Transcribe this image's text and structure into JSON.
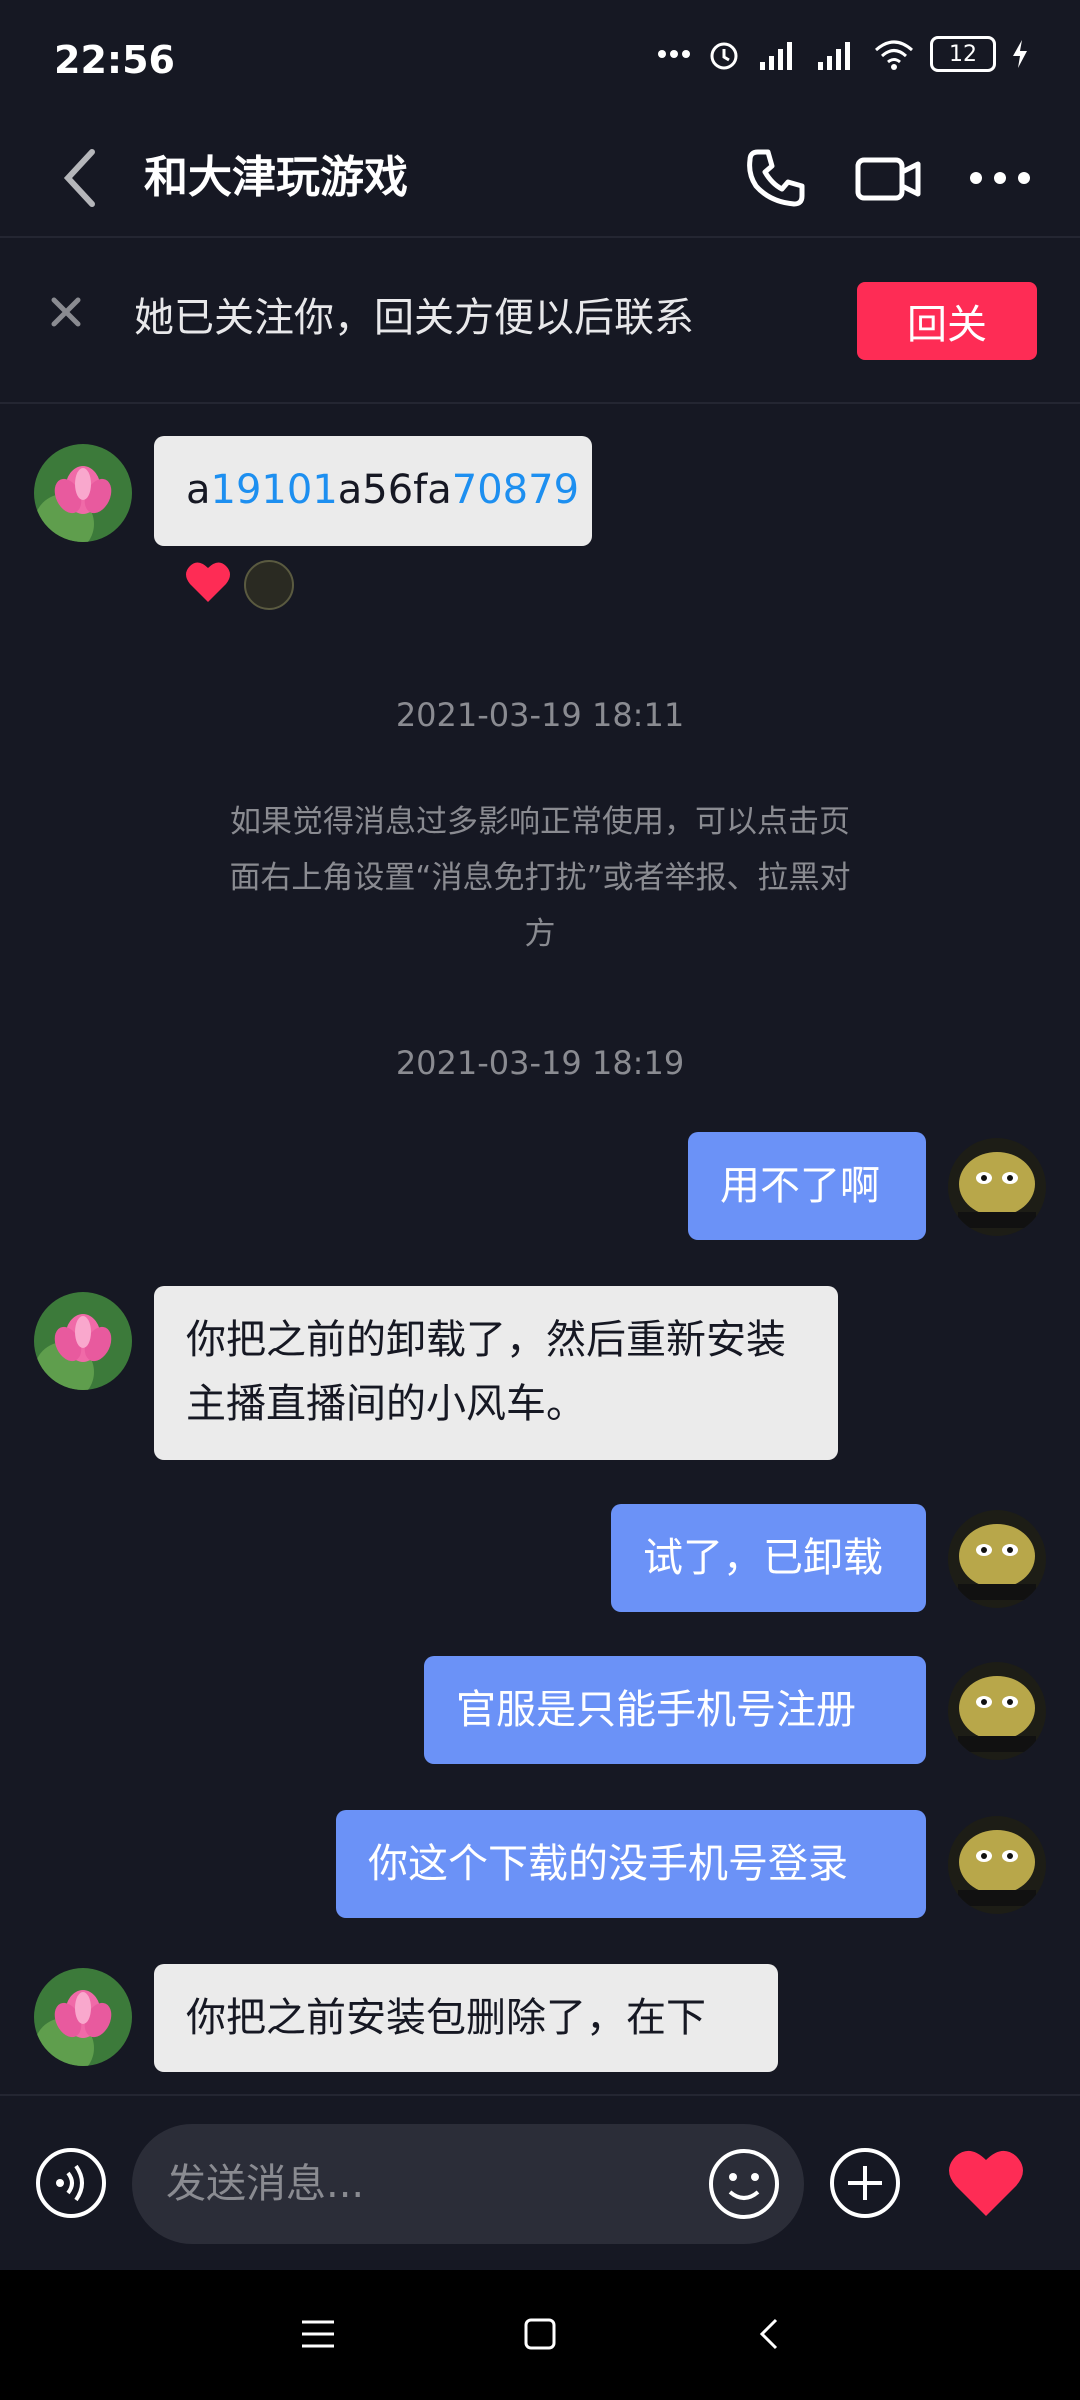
{
  "status": {
    "time": "22:56",
    "battery": "12"
  },
  "header": {
    "title": "和大津玩游戏"
  },
  "follow": {
    "text": "她已关注你，回关方便以后联系",
    "button": "回关"
  },
  "messages": {
    "m1": {
      "parts": [
        "a",
        "19101",
        "a56fa",
        "70879"
      ]
    },
    "ts1": "2021-03-19 18:11",
    "notice": "如果觉得消息过多影响正常使用，可以点击页面右上角设置“消息免打扰”或者举报、拉黑对方",
    "ts2": "2021-03-19 18:19",
    "m2": "用不了啊",
    "m3": "你把之前的卸载了，然后重新安装主播直播间的小风车。",
    "m4": "试了，已卸载",
    "m5": "官服是只能手机号注册",
    "m6": "你这个下载的没手机号登录",
    "m7": "你把之前安装包删除了，在下"
  },
  "compose": {
    "placeholder": "发送消息..."
  },
  "colors": {
    "background": "#161823",
    "accent": "#fe2c55",
    "outgoing": "#6b92f7",
    "incoming": "#ebebeb",
    "link": "#1d8ff0"
  }
}
